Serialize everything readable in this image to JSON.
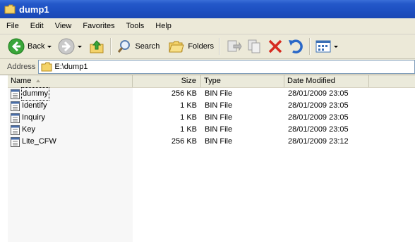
{
  "window": {
    "title": "dump1"
  },
  "menu": [
    "File",
    "Edit",
    "View",
    "Favorites",
    "Tools",
    "Help"
  ],
  "toolbar": {
    "back_label": "Back",
    "search_label": "Search",
    "folders_label": "Folders"
  },
  "address": {
    "label": "Address",
    "value": "E:\\dump1"
  },
  "columns": {
    "name": "Name",
    "size": "Size",
    "type": "Type",
    "date": "Date Modified"
  },
  "files": [
    {
      "name": "dummy",
      "size": "256 KB",
      "type": "BIN File",
      "date": "28/01/2009 23:05"
    },
    {
      "name": "Identify",
      "size": "1 KB",
      "type": "BIN File",
      "date": "28/01/2009 23:05"
    },
    {
      "name": "Inquiry",
      "size": "1 KB",
      "type": "BIN File",
      "date": "28/01/2009 23:05"
    },
    {
      "name": "Key",
      "size": "1 KB",
      "type": "BIN File",
      "date": "28/01/2009 23:05"
    },
    {
      "name": "Lite_CFW",
      "size": "256 KB",
      "type": "BIN File",
      "date": "28/01/2009 23:12"
    }
  ],
  "colors": {
    "titlebar": "#1d4fc1",
    "chrome": "#ece9d8",
    "sorted_column": "#f7f7f7"
  }
}
